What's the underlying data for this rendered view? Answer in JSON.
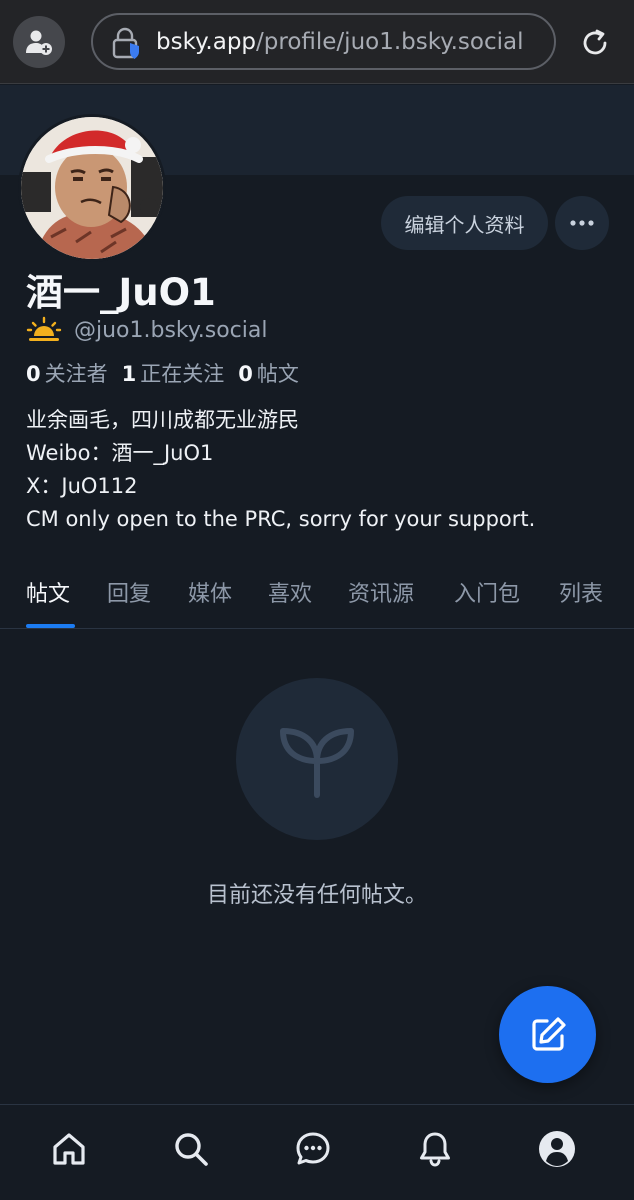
{
  "browser": {
    "url_host": "bsky.app",
    "url_path": "/profile/juo1.bsky.social"
  },
  "profile": {
    "edit_label": "编辑个人资料",
    "display_name": "酒一_JuO1",
    "handle": "@juo1.bsky.social",
    "stats": {
      "followers_count": "0",
      "followers_label": "关注者",
      "following_count": "1",
      "following_label": "正在关注",
      "posts_count": "0",
      "posts_label": "帖文"
    },
    "bio": [
      "业余画毛，四川成都无业游民",
      "Weibo：酒一_JuO1",
      "X：JuO112",
      "CM only open to the PRC, sorry for your support."
    ]
  },
  "tabs": [
    "帖文",
    "回复",
    "媒体",
    "喜欢",
    "资讯源",
    "入门包",
    "列表"
  ],
  "empty_state": {
    "message": "目前还没有任何帖文。",
    "icon": "sprout-icon"
  },
  "bottom_nav": {
    "icons": [
      "home-icon",
      "search-icon",
      "chat-icon",
      "bell-icon",
      "profile-icon"
    ]
  },
  "colors": {
    "background": "#151b23",
    "accent": "#1d6ff0",
    "tab_underline": "#1c7cf2"
  }
}
